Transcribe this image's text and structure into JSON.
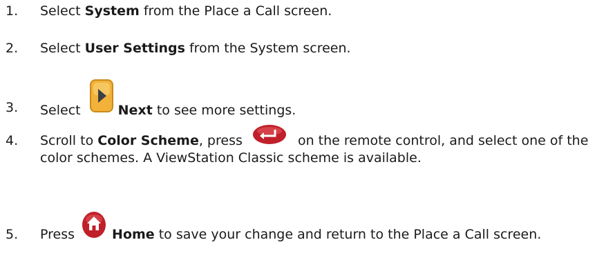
{
  "steps": [
    {
      "num": "1.",
      "pre": "Select ",
      "bold": "System",
      "post": " from the Place a Call screen."
    },
    {
      "num": "2.",
      "pre": "Select ",
      "bold": "User Settings",
      "post": " from the System screen."
    },
    {
      "num": "3.",
      "pre": "Select ",
      "icon": "next-arrow-icon",
      "bold": "Next",
      "post": " to see more settings."
    },
    {
      "num": "4.",
      "pre": "Scroll to ",
      "bold": "Color Scheme",
      "mid": ", press ",
      "icon": "enter-return-button-icon",
      "post": " on the remote control, and select one of the color schemes. A ViewStation Classic scheme is available."
    },
    {
      "num": "5.",
      "pre": "Press ",
      "icon": "home-button-icon",
      "bold": "Home",
      "post": " to save your change and return to the Place a Call screen."
    }
  ],
  "colors": {
    "text": "#1a1a1a",
    "next_icon_fill": "#f2b23a",
    "next_icon_arrow": "#3b4046",
    "enter_icon_fill": "#c0202a",
    "home_icon_fill": "#c0202a"
  }
}
